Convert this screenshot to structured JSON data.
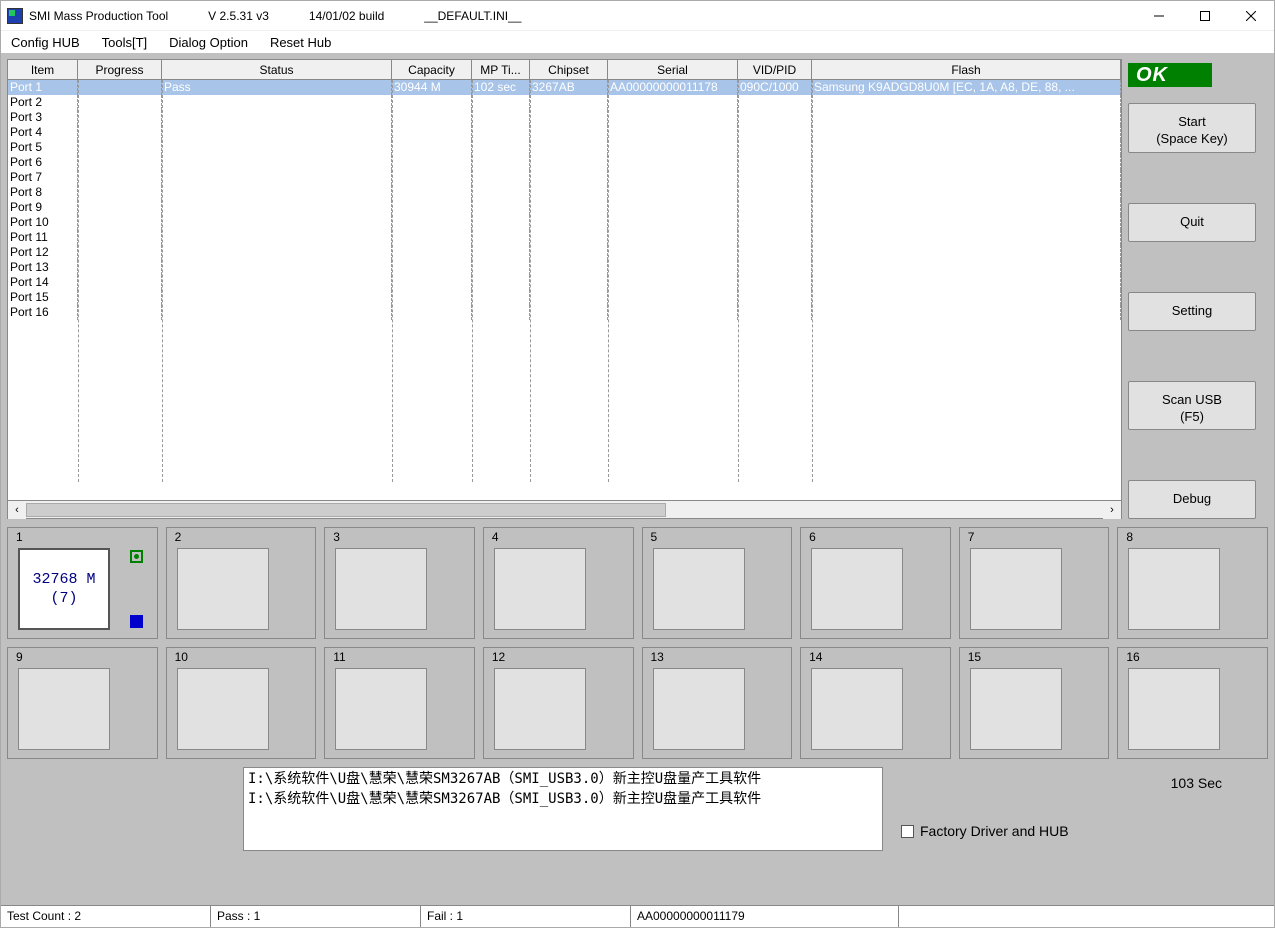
{
  "title": {
    "app": "SMI Mass Production Tool",
    "version": "V 2.5.31   v3",
    "build": "14/01/02 build",
    "ini": "__DEFAULT.INI__"
  },
  "menu": {
    "config_hub": "Config HUB",
    "tools": "Tools[T]",
    "dialog_option": "Dialog Option",
    "reset_hub": "Reset Hub"
  },
  "grid": {
    "headers": {
      "item": "Item",
      "progress": "Progress",
      "status": "Status",
      "capacity": "Capacity",
      "mptime": "MP Ti...",
      "chipset": "Chipset",
      "serial": "Serial",
      "vidpid": "VID/PID",
      "flash": "Flash"
    },
    "ports": [
      "Port 1",
      "Port 2",
      "Port 3",
      "Port 4",
      "Port 5",
      "Port 6",
      "Port 7",
      "Port 8",
      "Port 9",
      "Port 10",
      "Port 11",
      "Port 12",
      "Port 13",
      "Port 14",
      "Port 15",
      "Port 16"
    ],
    "row1": {
      "item": "Port 1",
      "status": "Pass",
      "capacity": "30944 M",
      "mptime": "102 sec",
      "chipset": "3267AB",
      "serial": "AA00000000011178",
      "vidpid": "090C/1000",
      "flash": "Samsung K9ADGD8U0M [EC, 1A, A8, DE, 88, ..."
    }
  },
  "side": {
    "ok": "OK",
    "start_l1": "Start",
    "start_l2": "(Space Key)",
    "quit": "Quit",
    "setting": "Setting",
    "scan_l1": "Scan USB",
    "scan_l2": "(F5)",
    "debug": "Debug"
  },
  "slots": {
    "numbers": [
      "1",
      "2",
      "3",
      "4",
      "5",
      "6",
      "7",
      "8",
      "9",
      "10",
      "11",
      "12",
      "13",
      "14",
      "15",
      "16"
    ],
    "slot1_l1": "32768 M",
    "slot1_l2": "(7)"
  },
  "log": {
    "line1": "I:\\系统软件\\U盘\\慧荣\\慧荣SM3267AB（SMI_USB3.0）新主控U盘量产工具软件",
    "line2": "I:\\系统软件\\U盘\\慧荣\\慧荣SM3267AB（SMI_USB3.0）新主控U盘量产工具软件"
  },
  "factory_hub_label": "Factory Driver and HUB",
  "elapsed": "103 Sec",
  "status": {
    "test_count": "Test Count : 2",
    "pass": "Pass : 1",
    "fail": "Fail : 1",
    "serial": "AA00000000011179"
  }
}
